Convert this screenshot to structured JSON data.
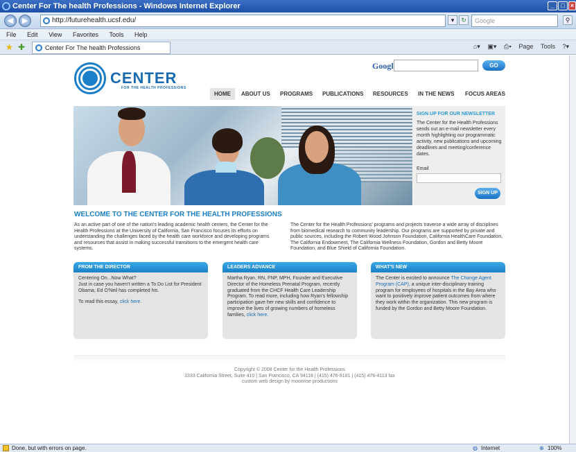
{
  "window": {
    "title": "Center For The health Professions - Windows Internet Explorer"
  },
  "address": {
    "url": "http://futurehealth.ucsf.edu/",
    "search_placeholder": "Google"
  },
  "menu": [
    "File",
    "Edit",
    "View",
    "Favorites",
    "Tools",
    "Help"
  ],
  "tab": {
    "label": "Center For The health Professions"
  },
  "toolbar": {
    "page": "Page",
    "tools": "Tools"
  },
  "site": {
    "logo_text": "CENTER",
    "logo_sub": "FOR THE HEALTH PROFESSIONS",
    "google_word": "Google",
    "go_label": "GO",
    "nav": [
      "HOME",
      "ABOUT US",
      "PROGRAMS",
      "PUBLICATIONS",
      "RESOURCES",
      "IN THE NEWS",
      "FOCUS AREAS"
    ]
  },
  "newsletter": {
    "title": "SIGN UP FOR OUR NEWSLETTER",
    "text": "The Center for the Health Professions sends out an e-mail newsletter every month highlighting our programmatic activity, new publications and upcoming deadlines and meeting/conference dates.",
    "email_label": "Email",
    "signup_label": "SIGN UP"
  },
  "welcome": {
    "heading": "WELCOME TO THE CENTER FOR THE HEALTH PROFESSIONS",
    "col1": "As an active part of one of the nation's leading academic health centers, the Center for the Health Professions at the University of California, San Francisco focuses its efforts on understanding the challenges faced by the health care workforce and developing programs and resources that assist in making successful transitions to the emergent health care systems.",
    "col2": "The Center for the Health Professions' programs and projects traverse a wide array of disciplines from biomedical research to community leadership. Our programs are supported by private and public sources, including the Robert Wood Johnson Foundation, California HealthCare Foundation, The California Endowment, The California Wellness Foundation, Gordon and Betty Moore Foundation, and Blue Shield of California Foundation."
  },
  "boxes": {
    "director": {
      "title": "FROM THE DIRECTOR",
      "p1": "Centering On...Now What?",
      "p2": "Just in case you haven't written a To Do List for President Obama, Ed O'Neil has completed his.",
      "p3": "To read this essay,",
      "link": "click here."
    },
    "leaders": {
      "title": "LEADERS ADVANCE",
      "text": "Martha Ryan, RN, FNP, MPH, Founder and Executive Director of the Homeless Prenatal Program, recently graduated from the CHCF Health Care Leadership Program. To read more, including how Ryan's fellowship participation gave her new skills and confidence to improve the lives of growing numbers of homeless families,",
      "link": "click here."
    },
    "new": {
      "title": "WHAT'S NEW",
      "text1": "The Center is excited to announce",
      "link": "The Change Agent Program (CAP),",
      "text2": "a unique inter-disciplinary training program for employees of hospitals in the Bay Area who want to positively improve patient outcomes from where they work within the organization. This new program is funded by the Gordon and Betty Moore Foundation."
    }
  },
  "footer": {
    "line1": "Copyright © 2008 Center for the Health Professions",
    "line2": "3333 California Street, Suite 410 | San Francisco, CA 94118 | (415) 476-8181 | (415) 476-4113 fax",
    "line3": "custom web design by moonrise productions"
  },
  "status": {
    "text": "Done, but with errors on page.",
    "zone": "Internet",
    "zoom": "100%"
  }
}
